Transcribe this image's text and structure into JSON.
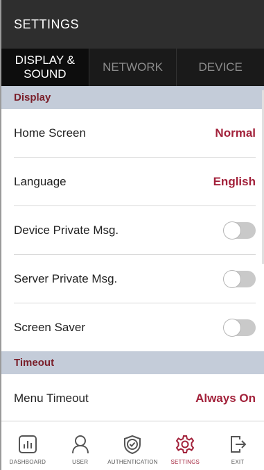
{
  "header": {
    "title": "SETTINGS"
  },
  "tabs": [
    {
      "label": "DISPLAY & SOUND",
      "line1": "DISPLAY &",
      "line2": "SOUND",
      "active": true
    },
    {
      "label": "NETWORK",
      "active": false
    },
    {
      "label": "DEVICE",
      "active": false
    }
  ],
  "sections": {
    "display": {
      "title": "Display",
      "rows": [
        {
          "label": "Home Screen",
          "value": "Normal"
        },
        {
          "label": "Language",
          "value": "English"
        },
        {
          "label": "Device Private Msg.",
          "toggle": false
        },
        {
          "label": "Server Private Msg.",
          "toggle": false
        },
        {
          "label": "Screen Saver",
          "toggle": false
        }
      ]
    },
    "timeout": {
      "title": "Timeout",
      "rows": [
        {
          "label": "Menu Timeout",
          "value": "Always On"
        }
      ]
    }
  },
  "nav": [
    {
      "label": "DASHBOARD",
      "icon": "dashboard-icon",
      "active": false
    },
    {
      "label": "USER",
      "icon": "user-icon",
      "active": false
    },
    {
      "label": "AUTHENTICATION",
      "icon": "shield-check-icon",
      "active": false
    },
    {
      "label": "SETTINGS",
      "icon": "gear-icon",
      "active": true
    },
    {
      "label": "EXIT",
      "icon": "exit-icon",
      "active": false
    }
  ],
  "colors": {
    "accent": "#a2213a",
    "header_bg": "#2e2e2e",
    "tab_bg": "#1a1a1a",
    "section_bg": "#c4ccd9"
  }
}
